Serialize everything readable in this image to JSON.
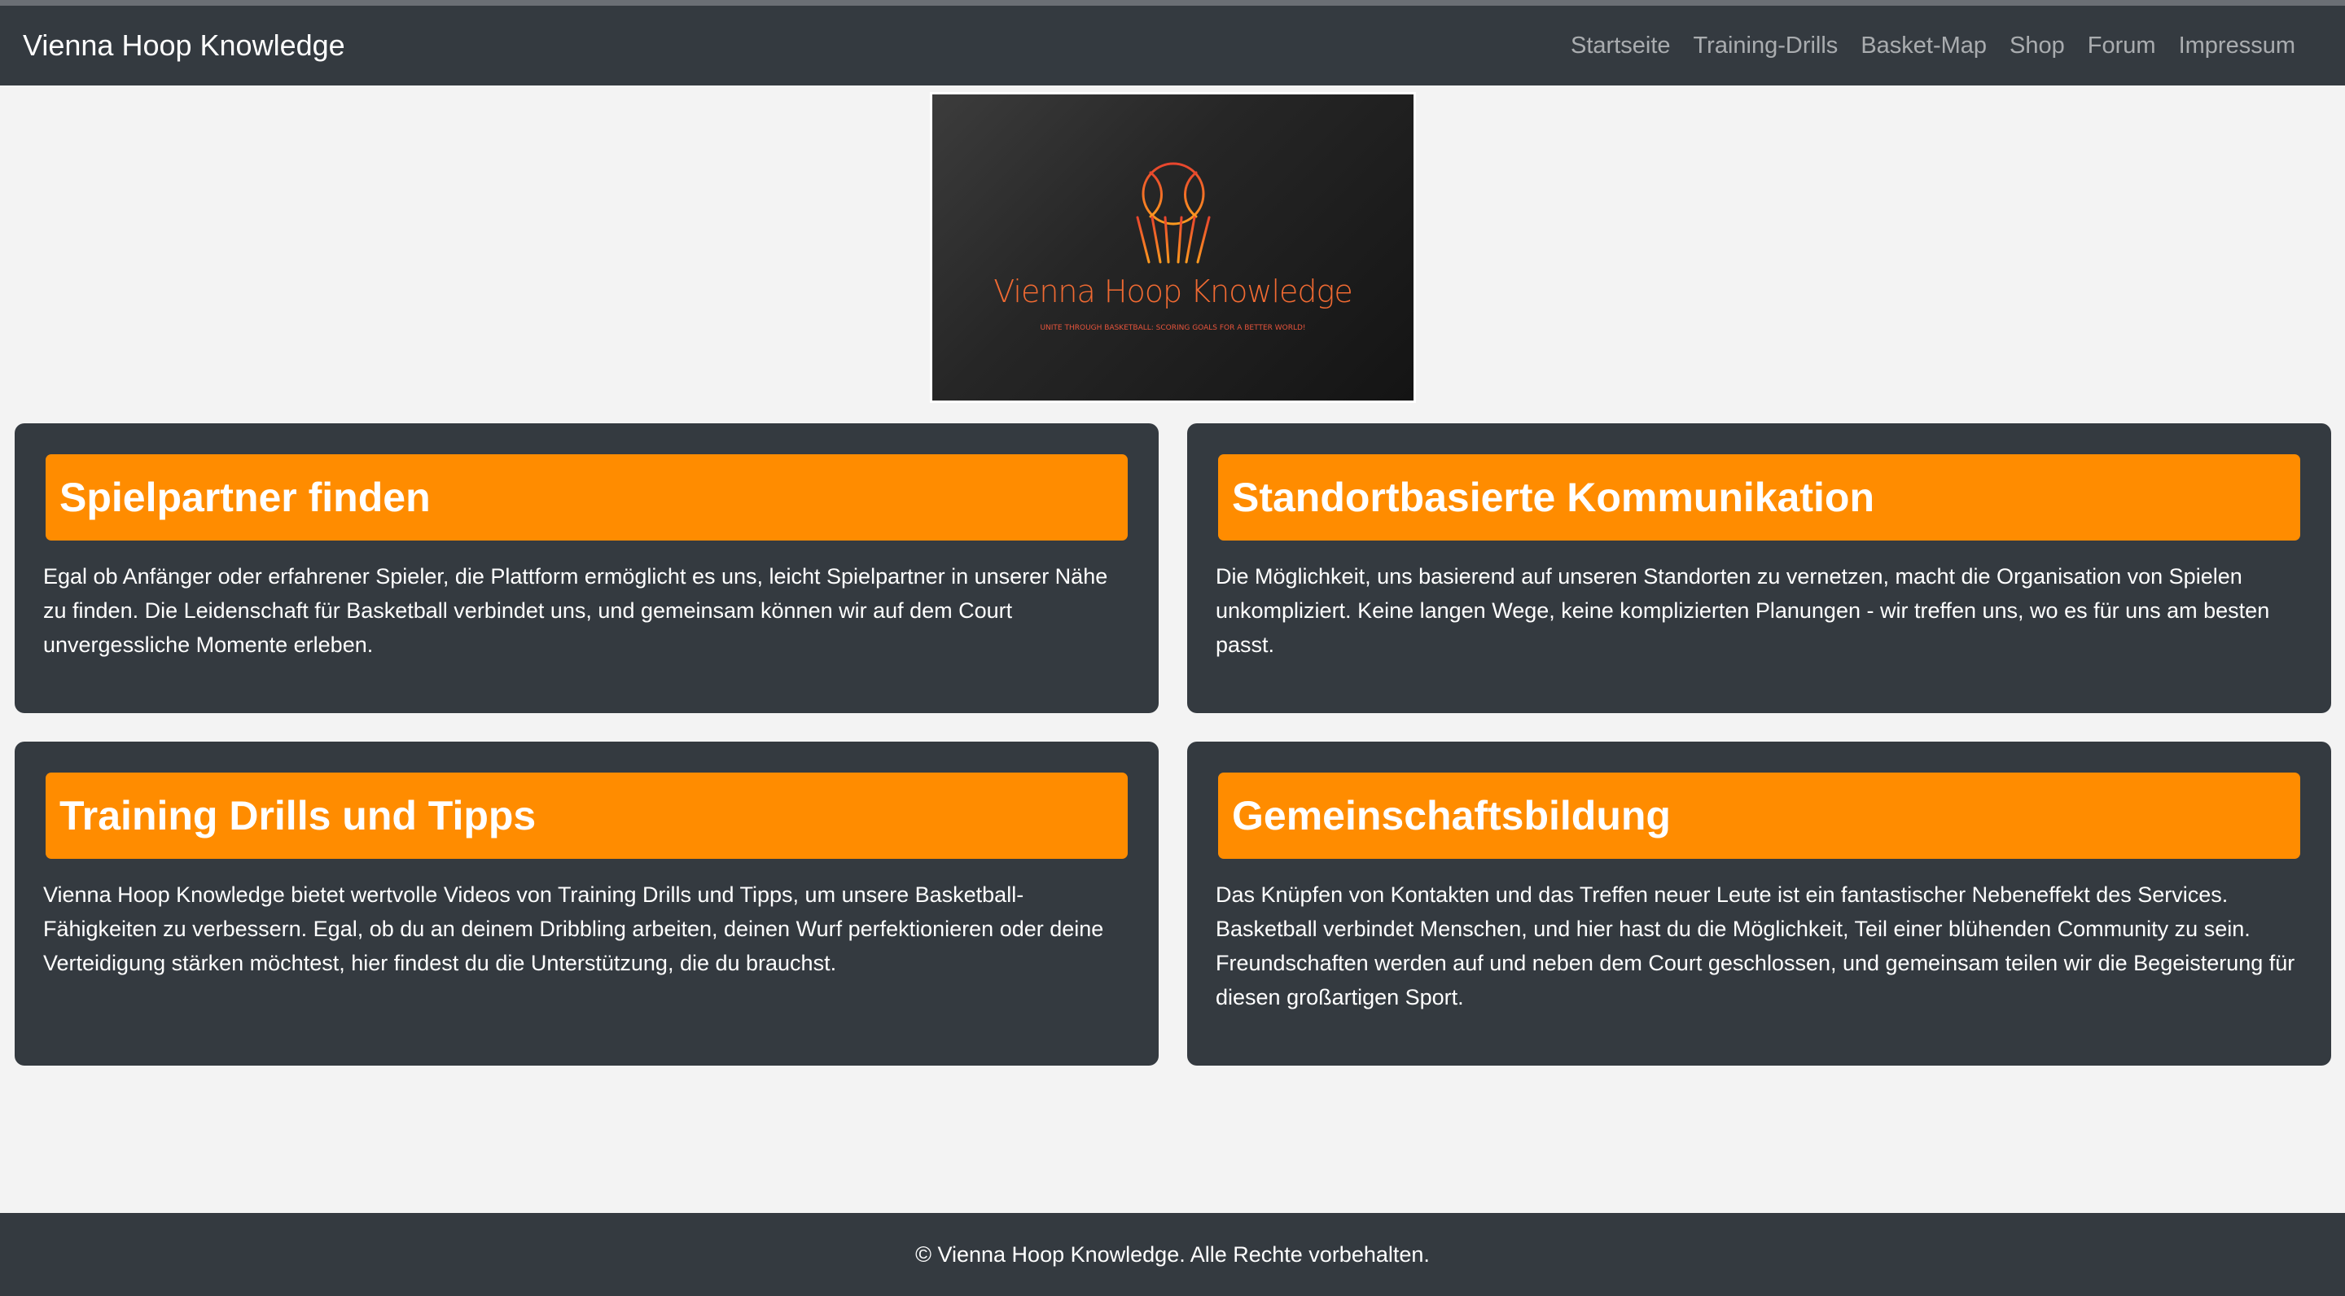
{
  "navbar": {
    "brand": "Vienna Hoop Knowledge",
    "links": [
      "Startseite",
      "Training-Drills",
      "Basket-Map",
      "Shop",
      "Forum",
      "Impressum"
    ]
  },
  "hero": {
    "title": "Vienna Hoop Knowledge",
    "slogan": "UNITE THROUGH BASKETBALL: SCORING GOALS FOR A BETTER WORLD!",
    "logo_icon": "basketball-hoop-icon"
  },
  "cards": [
    {
      "title": "Spielpartner finden",
      "text": "Egal ob Anfänger oder erfahrener Spieler, die Plattform ermöglicht es uns, leicht Spielpartner in unserer Nähe zu finden. Die Leidenschaft für Basketball verbindet uns, und gemeinsam können wir auf dem Court unvergessliche Momente erleben."
    },
    {
      "title": "Standortbasierte Kommunikation",
      "text": "Die Möglichkeit, uns basierend auf unseren Standorten zu vernetzen, macht die Organisation von Spielen unkompliziert. Keine langen Wege, keine komplizierten Planungen - wir treffen uns, wo es für uns am besten passt."
    },
    {
      "title": "Training Drills und Tipps",
      "text": "Vienna Hoop Knowledge bietet wertvolle Videos von Training Drills und Tipps, um unsere Basketball-Fähigkeiten zu verbessern. Egal, ob du an deinem Dribbling arbeiten, deinen Wurf perfektionieren oder deine Verteidigung stärken möchtest, hier findest du die Unterstützung, die du brauchst."
    },
    {
      "title": "Gemeinschaftsbildung",
      "text": "Das Knüpfen von Kontakten und das Treffen neuer Leute ist ein fantastischer Nebeneffekt des Services. Basketball verbindet Menschen, und hier hast du die Möglichkeit, Teil einer blühenden Community zu sein. Freundschaften werden auf und neben dem Court geschlossen, und gemeinsam teilen wir die Begeisterung für diesen großartigen Sport."
    }
  ],
  "footer": {
    "text": "© Vienna Hoop Knowledge. Alle Rechte vorbehalten."
  },
  "colors": {
    "navbar": "#343a40",
    "card": "#343a40",
    "accent": "#ff8c00",
    "background": "#f3f3f3"
  }
}
